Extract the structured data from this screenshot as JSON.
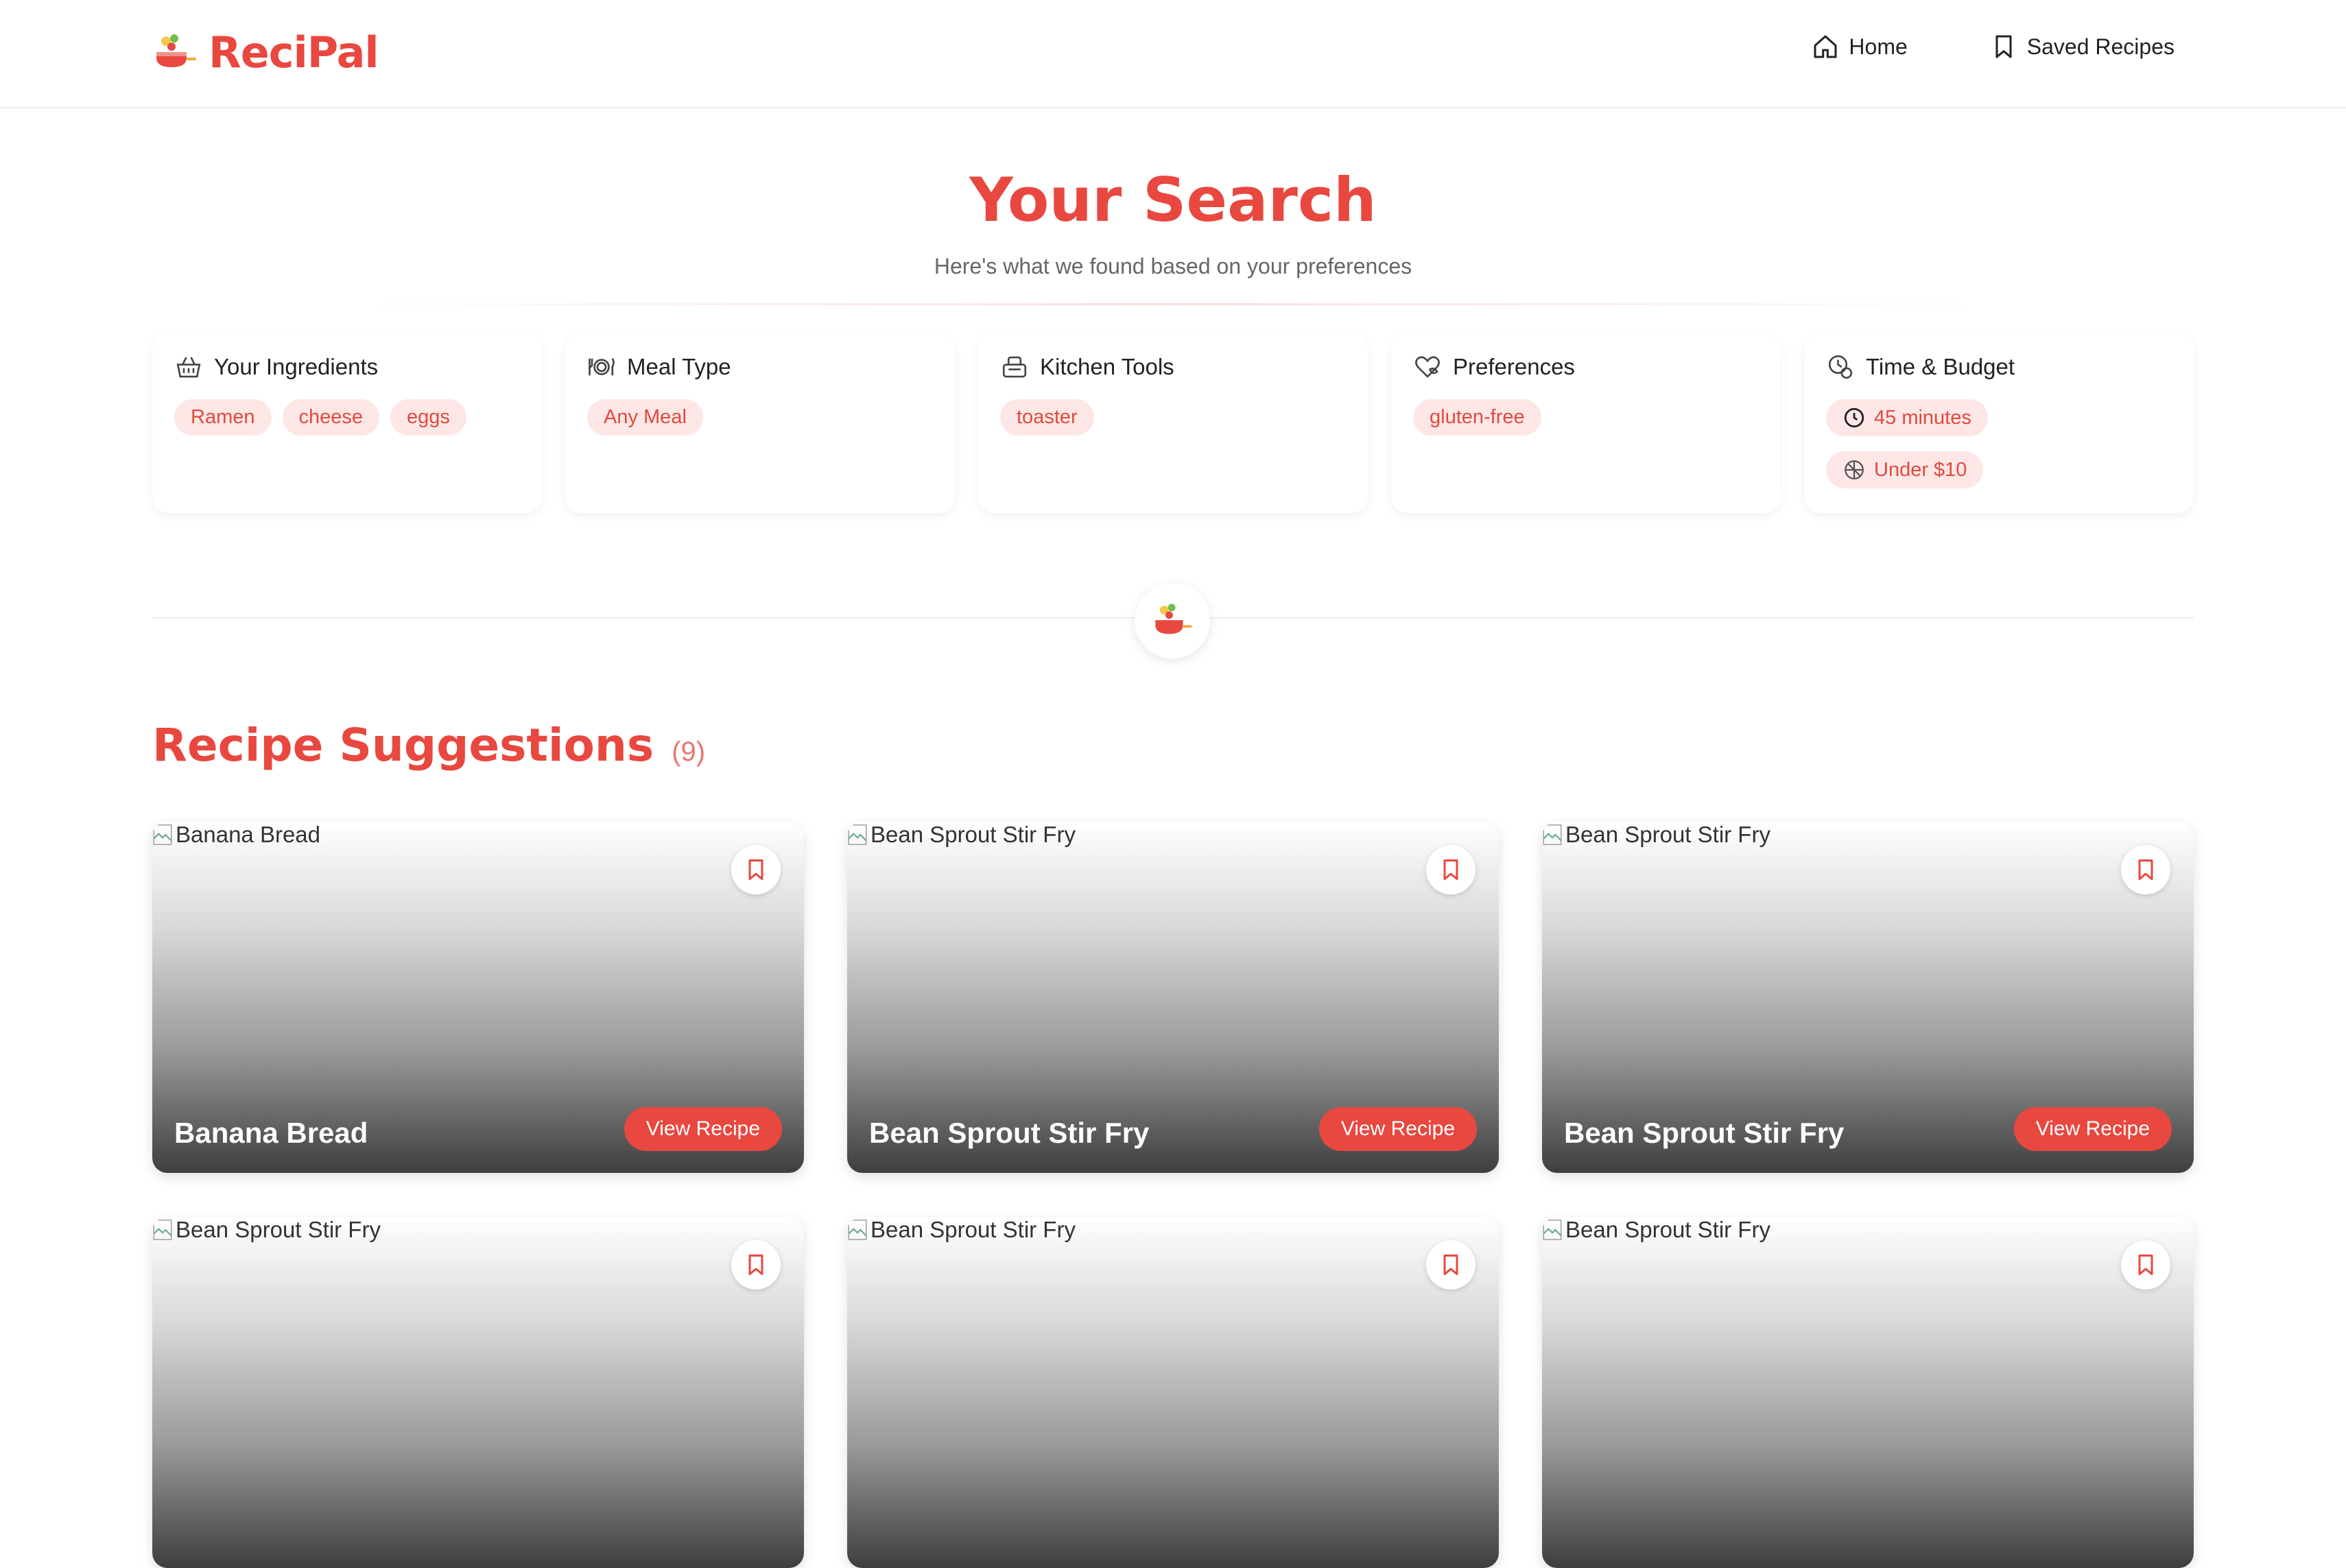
{
  "brand": {
    "name": "ReciPal",
    "accent": "#e8483f",
    "icon": "cooking-pot-logo"
  },
  "nav": [
    {
      "label": "Home",
      "icon": "home-icon"
    },
    {
      "label": "Saved Recipes",
      "icon": "bookmark-icon"
    }
  ],
  "hero": {
    "title": "Your Search",
    "subtitle": "Here's what we found based on your preferences"
  },
  "preferences": [
    {
      "title": "Your Ingredients",
      "icon": "basket-icon",
      "tags": [
        "Ramen",
        "cheese",
        "eggs"
      ]
    },
    {
      "title": "Meal Type",
      "icon": "plate-cutlery-icon",
      "tags": [
        "Any Meal"
      ]
    },
    {
      "title": "Kitchen Tools",
      "icon": "kitchen-tools-icon",
      "tags": [
        "toaster"
      ]
    },
    {
      "title": "Preferences",
      "icon": "heart-leaf-icon",
      "tags": [
        "gluten-free"
      ]
    },
    {
      "title": "Time & Budget",
      "icon": "clock-coin-icon",
      "tags": [
        "45 minutes",
        "Under $10"
      ]
    }
  ],
  "suggestions": {
    "title": "Recipe Suggestions",
    "count": "(9)",
    "view_label": "View Recipe",
    "recipes": [
      {
        "title": "Banana Bread",
        "alt": "Banana Bread"
      },
      {
        "title": "Bean Sprout Stir Fry",
        "alt": "Bean Sprout Stir Fry"
      },
      {
        "title": "Bean Sprout Stir Fry",
        "alt": "Bean Sprout Stir Fry"
      },
      {
        "title": "",
        "alt": "Bean Sprout Stir Fry"
      },
      {
        "title": "",
        "alt": "Bean Sprout Stir Fry"
      },
      {
        "title": "",
        "alt": "Bean Sprout Stir Fry"
      }
    ]
  }
}
